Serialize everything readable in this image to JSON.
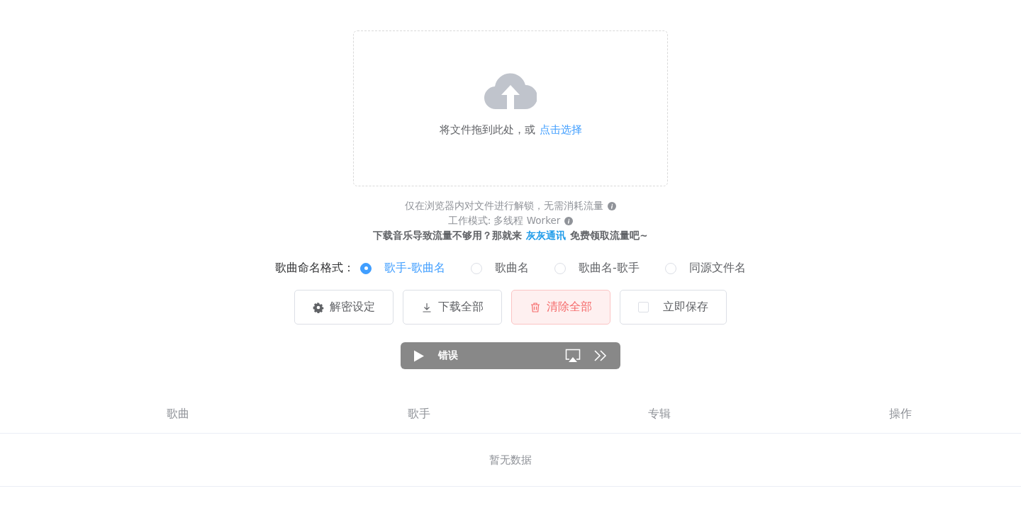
{
  "upload": {
    "prompt": "将文件拖到此处，或",
    "link": "点击选择"
  },
  "notes": [
    {
      "text": "仅在浏览器内对文件进行解锁，无需消耗流量",
      "info": true
    },
    {
      "text": "工作模式: 多线程 Worker",
      "info": true
    }
  ],
  "promo": {
    "before": "下载音乐导致流量不够用？那就来",
    "link": "灰灰通讯",
    "after": "免费领取流量吧~"
  },
  "naming": {
    "label": "歌曲命名格式：",
    "options": [
      {
        "label": "歌手-歌曲名",
        "selected": true
      },
      {
        "label": "歌曲名",
        "selected": false
      },
      {
        "label": "歌曲名-歌手",
        "selected": false
      },
      {
        "label": "同源文件名",
        "selected": false
      }
    ]
  },
  "actions": [
    {
      "kind": "settings",
      "label": "解密设定"
    },
    {
      "kind": "download",
      "label": "下载全部"
    },
    {
      "kind": "clear",
      "label": "清除全部"
    },
    {
      "kind": "checkbox",
      "label": "立即保存",
      "checked": false
    }
  ],
  "player": {
    "status": "错误"
  },
  "table": {
    "columns": [
      "歌曲",
      "歌手",
      "专辑",
      "操作"
    ],
    "empty": "暂无数据"
  }
}
